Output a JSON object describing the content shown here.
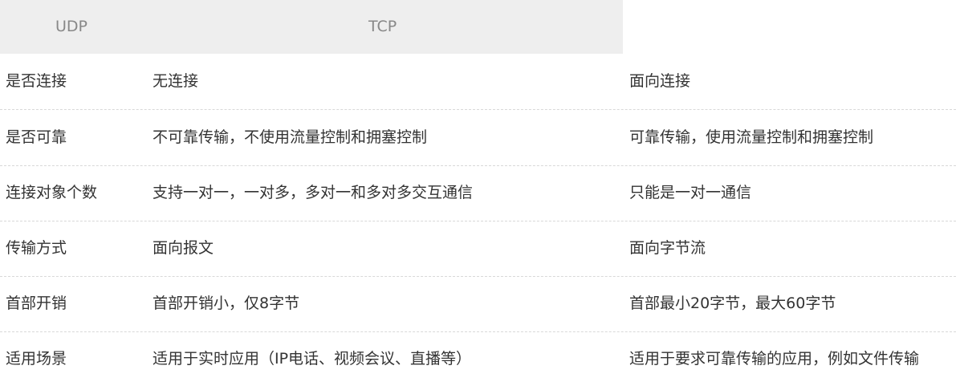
{
  "header": {
    "col_udp": "UDP",
    "col_tcp": "TCP"
  },
  "rows": [
    {
      "feature": "是否连接",
      "udp": "无连接",
      "tcp": "面向连接"
    },
    {
      "feature": "是否可靠",
      "udp": "不可靠传输，不使用流量控制和拥塞控制",
      "tcp": "可靠传输，使用流量控制和拥塞控制"
    },
    {
      "feature": "连接对象个数",
      "udp": "支持一对一，一对多，多对一和多对多交互通信",
      "tcp": "只能是一对一通信"
    },
    {
      "feature": "传输方式",
      "udp": "面向报文",
      "tcp": "面向字节流"
    },
    {
      "feature": "首部开销",
      "udp": "首部开销小，仅8字节",
      "tcp": "首部最小20字节，最大60字节"
    },
    {
      "feature": "适用场景",
      "udp": "适用于实时应用（IP电话、视频会议、直播等）",
      "tcp": "适用于要求可靠传输的应用，例如文件传输"
    }
  ],
  "colors": {
    "header_bg": "#eeeeee",
    "header_text": "#888888",
    "body_text": "#333333",
    "divider": "#d8d8d8"
  }
}
